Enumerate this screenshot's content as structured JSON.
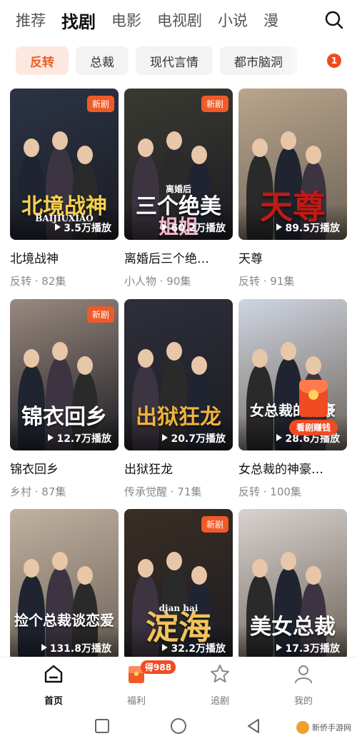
{
  "top_tabs": [
    "推荐",
    "找剧",
    "电影",
    "电视剧",
    "小说",
    "漫"
  ],
  "active_top_tab": 1,
  "chips": [
    "反转",
    "总裁",
    "现代言情",
    "都市脑洞"
  ],
  "chip_badge": "1",
  "new_label": "新剧",
  "dramas": [
    {
      "title": "北境战神",
      "meta": "反转 · 82集",
      "plays": "3.5万播放",
      "poster_text": "北境战神",
      "poster_sub": "BAIJIUXIAO",
      "is_new": true,
      "bg": "#2b3445",
      "accent": "#f6d04d"
    },
    {
      "title": "离婚后三个绝…",
      "meta": "小人物 · 90集",
      "plays": "60.2万播放",
      "poster_text": "三个绝美",
      "poster_sub": "离婚后",
      "poster_text2": "姐姐",
      "is_new": true,
      "bg": "#3a3a32",
      "accent": "#ffffff"
    },
    {
      "title": "天尊",
      "meta": "反转 · 91集",
      "plays": "89.5万播放",
      "poster_text": "天尊",
      "is_new": false,
      "bg": "#b9a58b",
      "accent": "#c01a14"
    },
    {
      "title": "锦衣回乡",
      "meta": "乡村 · 87集",
      "plays": "12.7万播放",
      "poster_text": "锦衣回乡",
      "is_new": true,
      "bg": "#9a8a80",
      "accent": "#ffffff"
    },
    {
      "title": "出狱狂龙",
      "meta": "传承觉醒 · 71集",
      "plays": "20.7万播放",
      "poster_text": "出狱狂龙",
      "is_new": false,
      "bg": "#2e2f3a",
      "accent": "#f0b23c"
    },
    {
      "title": "女总裁的神豪…",
      "meta": "反转 · 100集",
      "plays": "28.6万播放",
      "poster_text": "女总裁的神豪",
      "is_new": false,
      "bg": "#cfd6e2",
      "accent": "#ffffff"
    },
    {
      "title": "",
      "meta": "",
      "plays": "131.8万播放",
      "poster_text": "捡个总裁谈恋爱",
      "is_new": false,
      "bg": "#c0b2a0",
      "accent": "#ffffff"
    },
    {
      "title": "",
      "meta": "",
      "plays": "32.2万播放",
      "poster_text": "淀海",
      "poster_sub": "dian    hai",
      "is_new": true,
      "bg": "#3a2e24",
      "accent": "#f3c35a"
    },
    {
      "title": "",
      "meta": "",
      "plays": "17.3万播放",
      "poster_text": "美女总裁",
      "is_new": false,
      "bg": "#d8d3d0",
      "accent": "#ffffff"
    }
  ],
  "red_packet_label": "看剧赚钱",
  "bottom_tabs": [
    {
      "label": "首页",
      "icon": "home-icon",
      "active": true
    },
    {
      "label": "福利",
      "icon": "gift-icon",
      "active": false
    },
    {
      "label": "追剧",
      "icon": "star-icon",
      "active": false
    },
    {
      "label": "我的",
      "icon": "person-icon",
      "active": false
    }
  ],
  "welfare_badge": "得988",
  "watermark": "新侨手游网",
  "colors": {
    "accent": "#f05a28",
    "badge": "#f04b23"
  }
}
